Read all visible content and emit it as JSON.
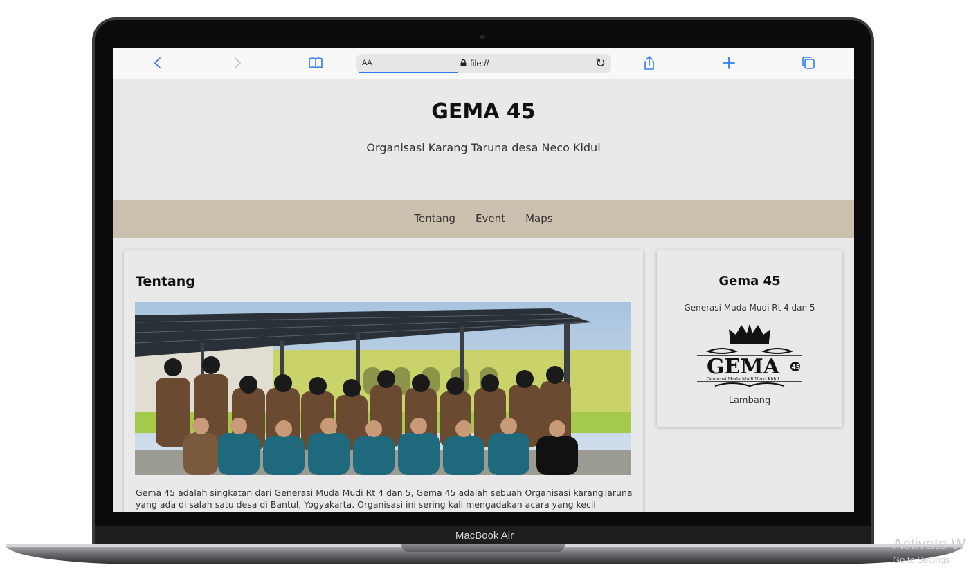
{
  "browser": {
    "reader_label": "AA",
    "url": "file://",
    "back_icon": "chevron-left-icon",
    "forward_icon": "chevron-right-icon",
    "bookmarks_icon": "book-icon",
    "share_icon": "share-icon",
    "new_tab_icon": "plus-icon",
    "tabs_icon": "tabs-icon",
    "reload_icon": "reload-icon",
    "accent": "#2f7cf6"
  },
  "header": {
    "title": "GEMA 45",
    "subtitle": "Organisasi Karang Taruna desa Neco Kidul"
  },
  "nav": {
    "items": [
      {
        "label": "Tentang"
      },
      {
        "label": "Event"
      },
      {
        "label": "Maps"
      }
    ],
    "color": "#cbbfad"
  },
  "main": {
    "title": "Tentang",
    "body": "Gema 45 adalah singkatan dari Generasi Muda Mudi Rt 4 dan 5, Gema 45 adalah sebuah Organisasi karangTaruna yang ada di salah satu desa di Bantul, Yogyakarta. Organisasi ini sering kali mengadakan acara yang kecil maupun"
  },
  "side": {
    "title": "Gema 45",
    "subtitle": "Generasi Muda Mudi Rt 4 dan 5",
    "logo_text": "GEMA",
    "logo_number": "45",
    "logo_tagline": "Generasi Muda Mudi Neco Kidul",
    "caption": "Lambang"
  },
  "device": {
    "model": "MacBook Air"
  },
  "watermark": {
    "line1": "Activate W",
    "line2": "Go to Settings"
  }
}
